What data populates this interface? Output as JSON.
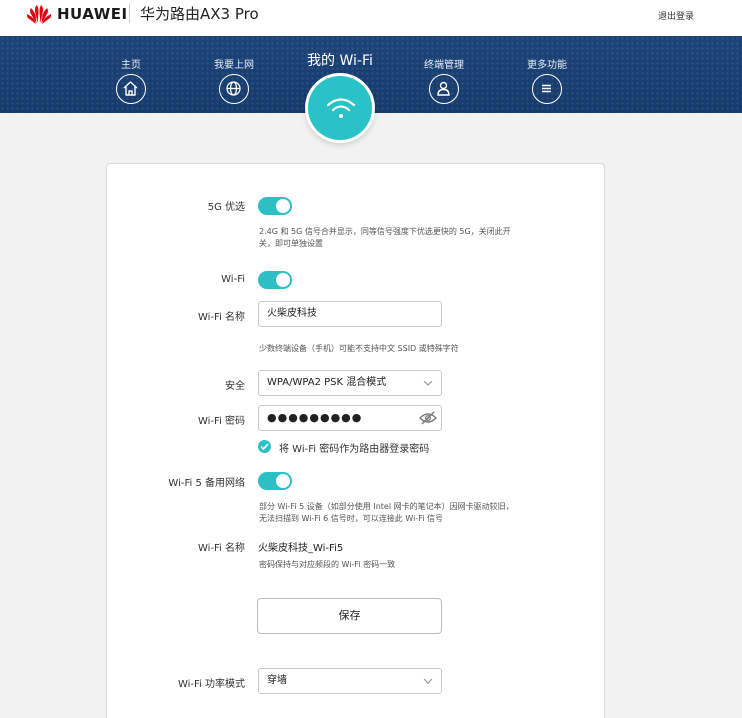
{
  "header": {
    "brand": "HUAWEI",
    "product": "华为路由AX3 Pro",
    "logout": "退出登录"
  },
  "nav": {
    "items": [
      {
        "label": "主页",
        "icon": "home-icon"
      },
      {
        "label": "我要上网",
        "icon": "globe-icon"
      },
      {
        "label": "终端管理",
        "icon": "user-icon"
      },
      {
        "label": "更多功能",
        "icon": "menu-icon"
      }
    ],
    "active": {
      "label": "我的 Wi-Fi",
      "icon": "wifi-icon"
    }
  },
  "settings": {
    "prefer5g": {
      "label": "5G 优选",
      "on": true,
      "hint": "2.4G 和 5G 信号合并显示，同等信号强度下优选更快的 5G，关闭此开关，即可单独设置"
    },
    "wifi": {
      "label": "Wi-Fi",
      "on": true
    },
    "wifi_name": {
      "label": "Wi-Fi 名称",
      "value": "火柴皮科技",
      "hint": "少数终端设备（手机）可能不支持中文 SSID 或特殊字符"
    },
    "security": {
      "label": "安全",
      "value": "WPA/WPA2 PSK 混合模式"
    },
    "password": {
      "label": "Wi-Fi 密码",
      "masked": "●●●●●●●●●"
    },
    "use_as_admin": {
      "label": "将 Wi-Fi 密码作为路由器登录密码",
      "checked": true
    },
    "wifi5_backup": {
      "label": "Wi-Fi 5 备用网络",
      "on": true,
      "hint": "部分 Wi-Fi 5 设备（如部分使用 Intel 网卡的笔记本）因网卡驱动较旧，无法扫描到 Wi-Fi 6 信号时，可以连接此 Wi-Fi 信号"
    },
    "wifi5_name": {
      "label": "Wi-Fi 名称",
      "value": "火柴皮科技_Wi-Fi5",
      "hint": "密码保持与对应频段的 Wi-Fi 密码一致"
    },
    "save": "保存",
    "power_mode": {
      "label": "Wi-Fi 功率模式",
      "value": "穿墙"
    }
  },
  "colors": {
    "accent": "#2cc0c4",
    "navband": "#1a3c6f"
  }
}
